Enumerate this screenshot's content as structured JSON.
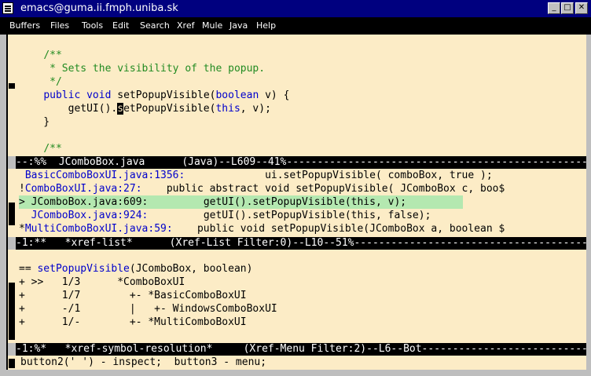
{
  "window": {
    "title": "emacs@guma.ii.fmph.uniba.sk"
  },
  "menubar": {
    "items": [
      "Buffers",
      "Files",
      "Tools",
      "Edit",
      "Search",
      "Xref",
      "Mule",
      "Java",
      "Help"
    ]
  },
  "code": {
    "comment_open": "/**",
    "comment_body": " * Sets the visibility of the popup.",
    "comment_close": " */",
    "sig_public": "public",
    "sig_void": "void",
    "sig_name": "setPopupVisible(",
    "sig_boolean": "boolean",
    "sig_rest": " v) {",
    "body_indent": "        getUI().",
    "body_cursor": "s",
    "body_after": "etPopupVisible(",
    "body_this": "this",
    "body_end": ", v);",
    "close_brace": "    }",
    "comment_open2": "/**"
  },
  "modeline1": "--:%%  JComboBox.java      (Java)--L609--41%--------------------------------------------------",
  "xref_list": [
    {
      "prefix": " ",
      "file": "BasicComboBoxUI.java:1356:",
      "code": "             ui.setPopupVisible( comboBox, true );"
    },
    {
      "prefix": "!",
      "file": "ComboBoxUI.java:27:",
      "code": "    public abstract void setPopupVisible( JComboBox c, boo$"
    },
    {
      "prefix": ">",
      "file": "JComboBox.java:609:",
      "code": "         getUI().setPopupVisible(this, v);"
    },
    {
      "prefix": " ",
      "file": "JComboBox.java:924:",
      "code": "         getUI().setPopupVisible(this, false);"
    },
    {
      "prefix": "*",
      "file": "MultiComboBoxUI.java:59:",
      "code": "    public void setPopupVisible(JComboBox a, boolean $"
    }
  ],
  "modeline2": "-1:**   *xref-list*      (Xref-List Filter:0)--L10--51%-------------------------------------------",
  "resolution": {
    "header_eq": "== ",
    "header_fn": "setPopupVisible",
    "header_rest": "(JComboBox, boolean)",
    "rows": [
      "+ >>   1/3      *ComboBoxUI",
      "+      1/7        +- *BasicComboBoxUI",
      "+      -/1        |   +- WindowsComboBoxUI",
      "+      1/-        +- *MultiComboBoxUI"
    ]
  },
  "modeline3": "-1:%*   *xref-symbol-resolution*     (Xref-Menu Filter:2)--L6--Bot-------------------------------",
  "echo_area": "button2(' ') - inspect;  button3 - menu;",
  "colors": {
    "title_bg": "#00007f",
    "buffer_bg": "#fcecc6",
    "keyword": "#0000cc",
    "comment": "#228b22",
    "highlight": "#b4e8b0"
  }
}
